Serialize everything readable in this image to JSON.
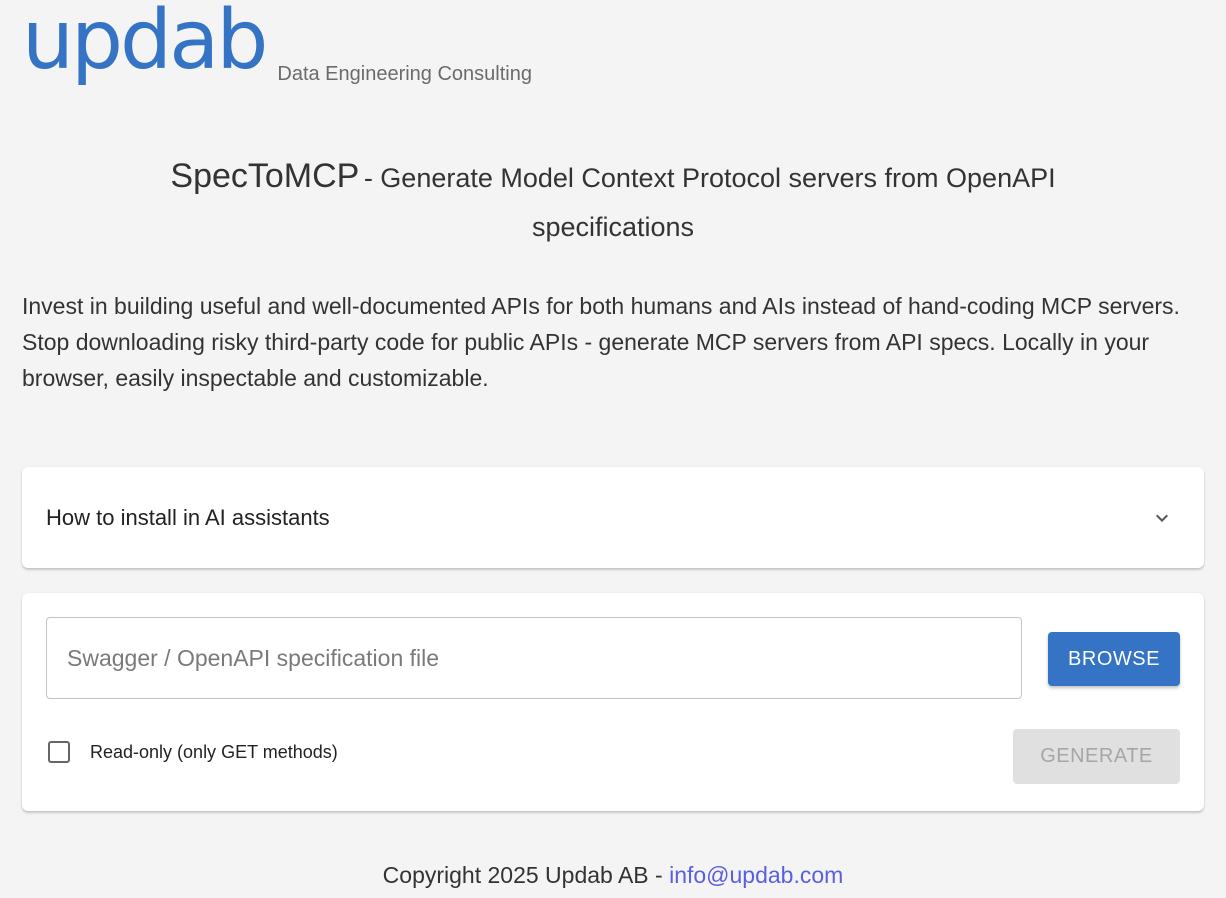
{
  "header": {
    "logo_text": "updab",
    "tagline": "Data Engineering Consulting"
  },
  "title": {
    "app_name": "SpecToMCP",
    "subtitle": "- Generate Model Context Protocol servers from OpenAPI specifications"
  },
  "intro": {
    "text": "Invest in building useful and well-documented APIs for both humans and AIs instead of hand-coding MCP servers. Stop downloading risky third-party code for public APIs - generate MCP servers from API specs. Locally in your browser, easily inspectable and customizable."
  },
  "accordion": {
    "title": "How to install in AI assistants",
    "expanded": false,
    "icon": "chevron-down-icon"
  },
  "form": {
    "file_input_placeholder": "Swagger / OpenAPI specification file",
    "browse_label": "BROWSE",
    "readonly_label": "Read-only (only GET methods)",
    "readonly_checked": false,
    "generate_label": "GENERATE",
    "generate_disabled": true
  },
  "footer": {
    "copyright": "Copyright 2025 Updab AB - ",
    "email": "info@updab.com"
  },
  "colors": {
    "brand": "#3573c4",
    "background": "#f4f4f4",
    "link": "#5a5fe0",
    "disabled_bg": "#e0e0e0"
  }
}
